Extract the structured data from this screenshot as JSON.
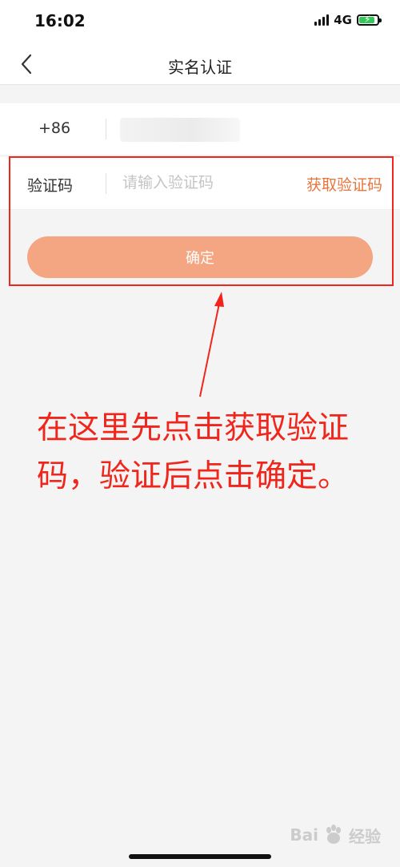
{
  "status_bar": {
    "time": "16:02",
    "network": "4G",
    "battery_level": 0.85,
    "battery_color": "#35c759",
    "icons": [
      "signal-icon",
      "battery-charging-icon"
    ]
  },
  "nav": {
    "title": "实名认证",
    "back_icon": "chevron-left-icon"
  },
  "form": {
    "phone_prefix": "+86",
    "code_label": "验证码",
    "code_placeholder": "请输入验证码",
    "code_value": "",
    "get_code_label": "获取验证码",
    "confirm_label": "确定"
  },
  "annotation": {
    "text": "在这里先点击获取验证码，验证后点击确定。"
  },
  "watermark": {
    "icon": "baidu-paw-icon"
  },
  "colors": {
    "accent": "#e8743c",
    "confirm_button": "#f4a581",
    "annotation_red": "#f0261c",
    "background": "#f4f4f4"
  }
}
